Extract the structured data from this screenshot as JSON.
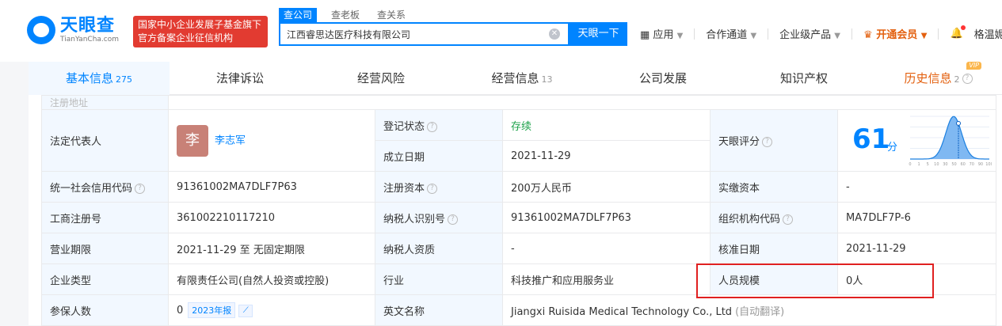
{
  "header": {
    "logo_main": "天眼查",
    "logo_sub": "TianYanCha.com",
    "slogan_line1": "国家中小企业发展子基金旗下",
    "slogan_line2": "官方备案企业征信机构",
    "search_tabs": [
      "查公司",
      "查老板",
      "查关系"
    ],
    "search_value": "江西睿思达医疗科技有限公司",
    "search_button": "天眼一下",
    "nav": {
      "apps": "应用",
      "channel": "合作通道",
      "enterprise": "企业级产品",
      "vip": "开通会员",
      "user": "格温妮..."
    }
  },
  "tabs": [
    {
      "label": "基本信息",
      "count": "275"
    },
    {
      "label": "法律诉讼",
      "count": ""
    },
    {
      "label": "经营风险",
      "count": ""
    },
    {
      "label": "经营信息",
      "count": "13"
    },
    {
      "label": "公司发展",
      "count": ""
    },
    {
      "label": "知识产权",
      "count": ""
    },
    {
      "label": "历史信息",
      "count": "2",
      "badge": "VIP"
    }
  ],
  "info": {
    "clipped_row": "注册地址",
    "legal_rep_label": "法定代表人",
    "legal_rep_avatar": "李",
    "legal_rep_name": "李志军",
    "reg_status_label": "登记状态",
    "reg_status": "存续",
    "est_date_label": "成立日期",
    "est_date": "2021-11-29",
    "score_label": "天眼评分",
    "score": "61",
    "score_unit": "分",
    "credit_code_label": "统一社会信用代码",
    "credit_code": "91361002MA7DLF7P63",
    "reg_capital_label": "注册资本",
    "reg_capital": "200万人民币",
    "paid_capital_label": "实缴资本",
    "paid_capital": "-",
    "reg_no_label": "工商注册号",
    "reg_no": "361002210117210",
    "taxpayer_id_label": "纳税人识别号",
    "taxpayer_id": "91361002MA7DLF7P63",
    "org_code_label": "组织机构代码",
    "org_code": "MA7DLF7P-6",
    "term_label": "营业期限",
    "term": "2021-11-29 至 无固定期限",
    "taxpayer_qual_label": "纳税人资质",
    "taxpayer_qual": "-",
    "approval_date_label": "核准日期",
    "approval_date": "2021-11-29",
    "company_type_label": "企业类型",
    "company_type": "有限责任公司(自然人投资或控股)",
    "industry_label": "行业",
    "industry": "科技推广和应用服务业",
    "staff_size_label": "人员规模",
    "staff_size": "0人",
    "insured_label": "参保人数",
    "insured": "0",
    "insured_year": "2023年报",
    "english_name_label": "英文名称",
    "english_name": "Jiangxi Ruisida Medical Technology Co., Ltd",
    "auto_translate": "(自动翻译)"
  },
  "score_chart": {
    "ticks": [
      "0",
      "1",
      "5",
      "10",
      "30",
      "50",
      "60",
      "70",
      "90",
      "100"
    ],
    "marker": 61
  }
}
